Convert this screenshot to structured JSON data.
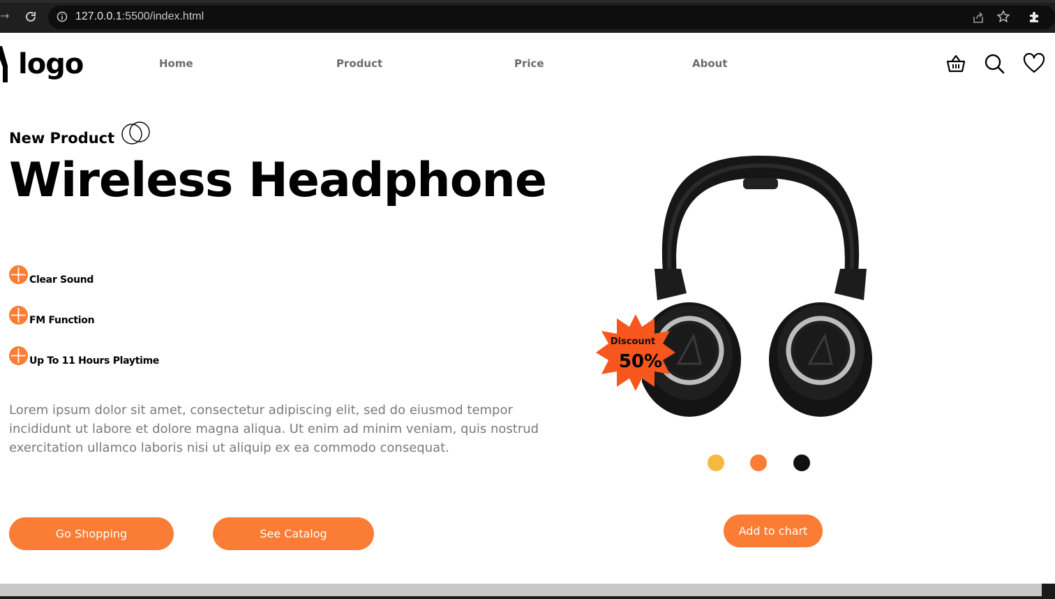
{
  "browser": {
    "url_host": "127.0.0.1",
    "url_rest": ":5500/index.html"
  },
  "header": {
    "logo_text": "logo",
    "nav": [
      "Home",
      "Product",
      "Price",
      "About"
    ],
    "icons": [
      "basket-icon",
      "search-icon",
      "heart-icon"
    ]
  },
  "hero": {
    "kicker": "New Product",
    "title": "Wireless Headphone",
    "features": [
      "Clear Sound",
      "FM Function",
      "Up To 11 Hours Playtime"
    ],
    "description": "Lorem ipsum dolor sit amet, consectetur adipiscing elit, sed do eiusmod tempor incididunt ut labore et dolore magna aliqua. Ut enim ad minim veniam, quis nostrud exercitation ullamco laboris nisi ut aliquip ex ea commodo consequat.",
    "buttons": {
      "shop": "Go Shopping",
      "catalog": "See Catalog"
    }
  },
  "product": {
    "badge_label": "Discount",
    "badge_value": "50%",
    "color_options": [
      "#f5b841",
      "#fb7c34",
      "#111111"
    ],
    "cart_button": "Add to chart"
  },
  "colors": {
    "accent": "#fb7c34",
    "badge": "#f7571e"
  }
}
